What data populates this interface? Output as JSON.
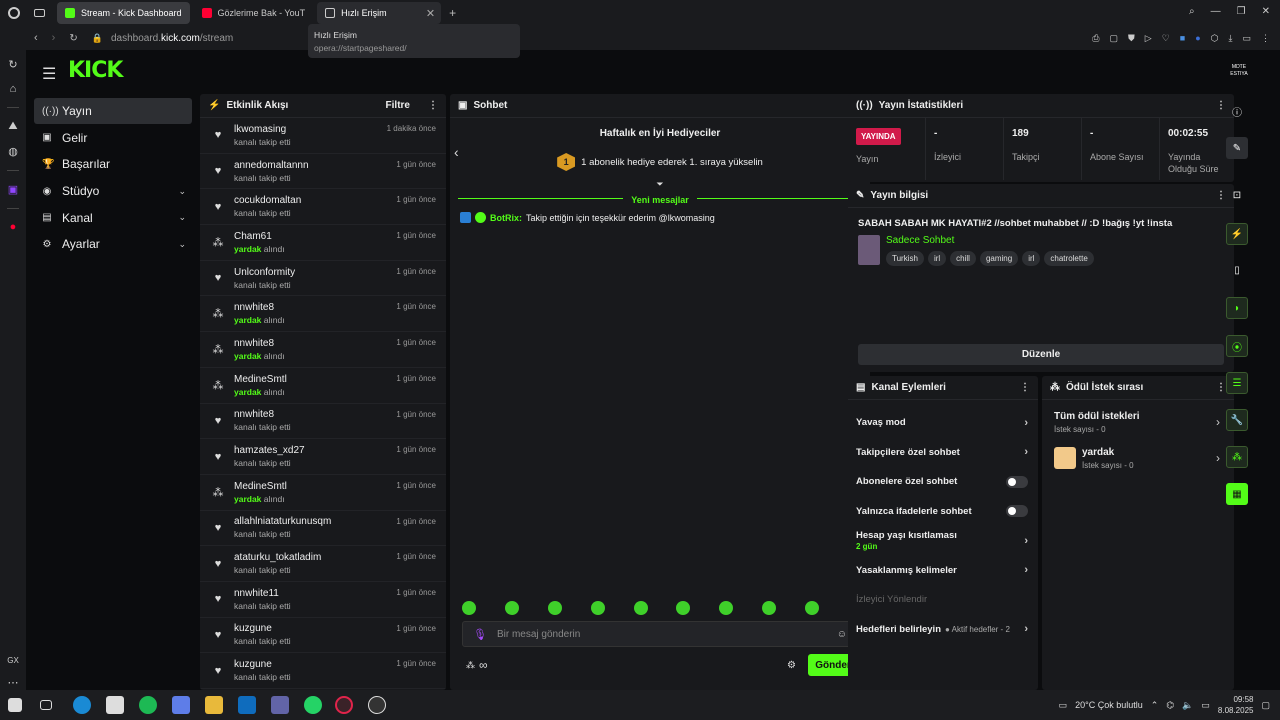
{
  "browser": {
    "tabs": [
      {
        "label": "Stream - Kick Dashboard",
        "color": "#53fc18"
      },
      {
        "label": "Gözlerime Bak - YouT",
        "color": "#ff0033"
      },
      {
        "label": "Hızlı Erişim",
        "color": "#888888"
      }
    ],
    "address_prefix": "dashboard.",
    "address_domain": "kick.com",
    "address_path": "/stream",
    "tooltip_title": "Hızlı Erişim",
    "tooltip_url": "opera://startpageshared/"
  },
  "brand": {
    "logo": "KICK",
    "avatar_text": "MDTE ESTIYA"
  },
  "nav": [
    {
      "label": "Yayın",
      "icon": "((·))",
      "active": true
    },
    {
      "label": "Gelir",
      "icon": "▣"
    },
    {
      "label": "Başarılar",
      "icon": "🏆"
    },
    {
      "label": "Stüdyo",
      "icon": "◉",
      "chevron": "⌄"
    },
    {
      "label": "Kanal",
      "icon": "▤",
      "chevron": "⌄"
    },
    {
      "label": "Ayarlar",
      "icon": "⚙",
      "chevron": "⌄"
    }
  ],
  "activity": {
    "title": "Etkinlik Akışı",
    "filter_label": "Filtre",
    "items": [
      {
        "name": "lkwomasing",
        "time": "1 dakika önce",
        "desc": "kanalı takip etti",
        "type": "follow"
      },
      {
        "name": "annedomaltannn",
        "time": "1 gün önce",
        "desc": "kanalı takip etti",
        "type": "follow"
      },
      {
        "name": "cocukdomaltan",
        "time": "1 gün önce",
        "desc": "kanalı takip etti",
        "type": "follow"
      },
      {
        "name": "Cham61",
        "time": "1 gün önce",
        "desc_green": "yardak",
        "desc": " alındı",
        "type": "reward"
      },
      {
        "name": "Unlconformity",
        "time": "1 gün önce",
        "desc": "kanalı takip etti",
        "type": "follow"
      },
      {
        "name": "nnwhite8",
        "time": "1 gün önce",
        "desc_green": "yardak",
        "desc": " alındı",
        "type": "reward"
      },
      {
        "name": "nnwhite8",
        "time": "1 gün önce",
        "desc_green": "yardak",
        "desc": " alındı",
        "type": "reward"
      },
      {
        "name": "MedineSmtl",
        "time": "1 gün önce",
        "desc_green": "yardak",
        "desc": " alındı",
        "type": "reward"
      },
      {
        "name": "nnwhite8",
        "time": "1 gün önce",
        "desc": "kanalı takip etti",
        "type": "follow"
      },
      {
        "name": "hamzates_xd27",
        "time": "1 gün önce",
        "desc": "kanalı takip etti",
        "type": "follow"
      },
      {
        "name": "MedineSmtl",
        "time": "1 gün önce",
        "desc_green": "yardak",
        "desc": " alındı",
        "type": "reward"
      },
      {
        "name": "allahlniataturkunusqm",
        "time": "1 gün önce",
        "desc": "kanalı takip etti",
        "type": "follow"
      },
      {
        "name": "ataturku_tokatladim",
        "time": "1 gün önce",
        "desc": "kanalı takip etti",
        "type": "follow"
      },
      {
        "name": "nnwhite11",
        "time": "1 gün önce",
        "desc": "kanalı takip etti",
        "type": "follow"
      },
      {
        "name": "kuzgune",
        "time": "1 gün önce",
        "desc": "kanalı takip etti",
        "type": "follow"
      },
      {
        "name": "kuzgune",
        "time": "1 gün önce",
        "desc": "kanalı takip etti",
        "type": "follow"
      }
    ]
  },
  "chat": {
    "title": "Sohbet",
    "top_gifters": "Haftalık en İyi Hediyeciler",
    "gift_rank": "1",
    "gift_text": "1 abonelik hediye ederek 1. sıraya yükselin",
    "new_messages": "Yeni mesajlar",
    "bot_name": "BotRix:",
    "bot_message": "Takip ettiğin için teşekkür ederim @lkwomasing",
    "input_placeholder": "Bir mesaj gönderin",
    "send_label": "Gönder",
    "infinity": "∞"
  },
  "stats": {
    "title": "Yayın İstatistikleri",
    "live_badge": "YAYINDA",
    "items": [
      {
        "value": "",
        "label": "Yayın"
      },
      {
        "value": "-",
        "label": "İzleyici"
      },
      {
        "value": "189",
        "label": "Takipçi"
      },
      {
        "value": "-",
        "label": "Abone Sayısı"
      },
      {
        "value": "00:02:55",
        "label": "Yayında Olduğu Süre"
      }
    ]
  },
  "stream_info": {
    "title": "Yayın bilgisi",
    "stream_title": "SABAH SABAH MK HAYATI#2 //sohbet muhabbet // :D !bağış !yt !insta",
    "category": "Sadece Sohbet",
    "tags": [
      "Turkish",
      "irl",
      "chill",
      "gaming",
      "irl",
      "chatrolette"
    ],
    "edit_label": "Düzenle"
  },
  "channel_actions": {
    "title": "Kanal Eylemleri",
    "items": [
      {
        "label": "Yavaş mod",
        "control": "chevron"
      },
      {
        "label": "Takipçilere özel sohbet",
        "control": "chevron"
      },
      {
        "label": "Abonelere özel sohbet",
        "control": "toggle"
      },
      {
        "label": "Yalnızca ifadelerle sohbet",
        "control": "toggle"
      },
      {
        "label": "Hesap yaşı kısıtlaması",
        "sub": "2 gün",
        "control": "chevron"
      },
      {
        "label": "Yasaklanmış kelimeler",
        "control": "chevron"
      },
      {
        "label": "İzleyici Yönlendir",
        "control": "none",
        "disabled": true
      },
      {
        "label": "Hedefleri belirleyin",
        "sub_inline": "Aktif hedefler - 2",
        "control": "chevron"
      }
    ]
  },
  "rewards": {
    "title": "Ödül İstek sırası",
    "items": [
      {
        "label": "Tüm ödül istekleri",
        "sub": "İstek sayısı - 0"
      },
      {
        "label": "yardak",
        "sub": "İstek sayısı - 0"
      }
    ]
  },
  "taskbar": {
    "weather": "20°C  Çok bulutlu",
    "time": "09:58",
    "date": "8.08.2025"
  }
}
